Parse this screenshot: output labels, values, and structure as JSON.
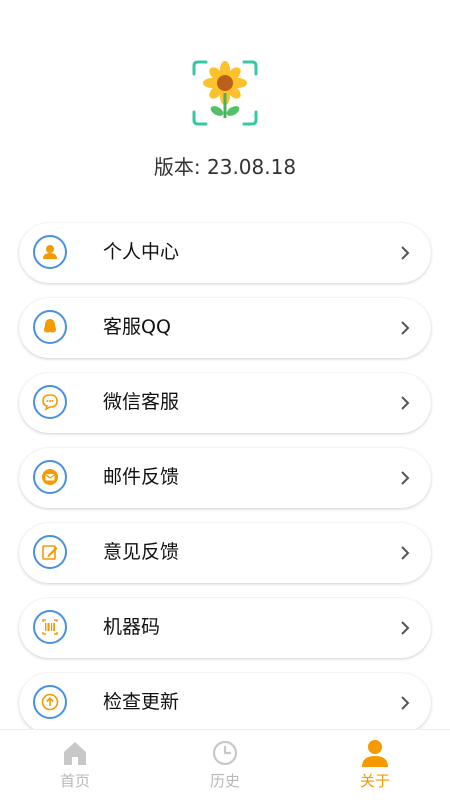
{
  "app": {
    "logo_icon": "sunflower-scan-icon",
    "version_text": "版本: 23.08.18"
  },
  "menu": {
    "items": [
      {
        "label": "个人中心",
        "icon": "user-icon"
      },
      {
        "label": "客服QQ",
        "icon": "qq-penguin-icon"
      },
      {
        "label": "微信客服",
        "icon": "chat-bubble-icon"
      },
      {
        "label": "邮件反馈",
        "icon": "mail-icon"
      },
      {
        "label": "意见反馈",
        "icon": "edit-icon"
      },
      {
        "label": "机器码",
        "icon": "barcode-icon"
      },
      {
        "label": "检查更新",
        "icon": "upload-icon"
      }
    ]
  },
  "tabbar": {
    "tabs": [
      {
        "label": "首页",
        "icon": "home-icon",
        "active": false
      },
      {
        "label": "历史",
        "icon": "clock-icon",
        "active": false
      },
      {
        "label": "关于",
        "icon": "person-icon",
        "active": true
      }
    ]
  },
  "colors": {
    "accent": "#f59a00",
    "icon_ring": "#4a90e2",
    "inactive": "#b8b8b8"
  }
}
